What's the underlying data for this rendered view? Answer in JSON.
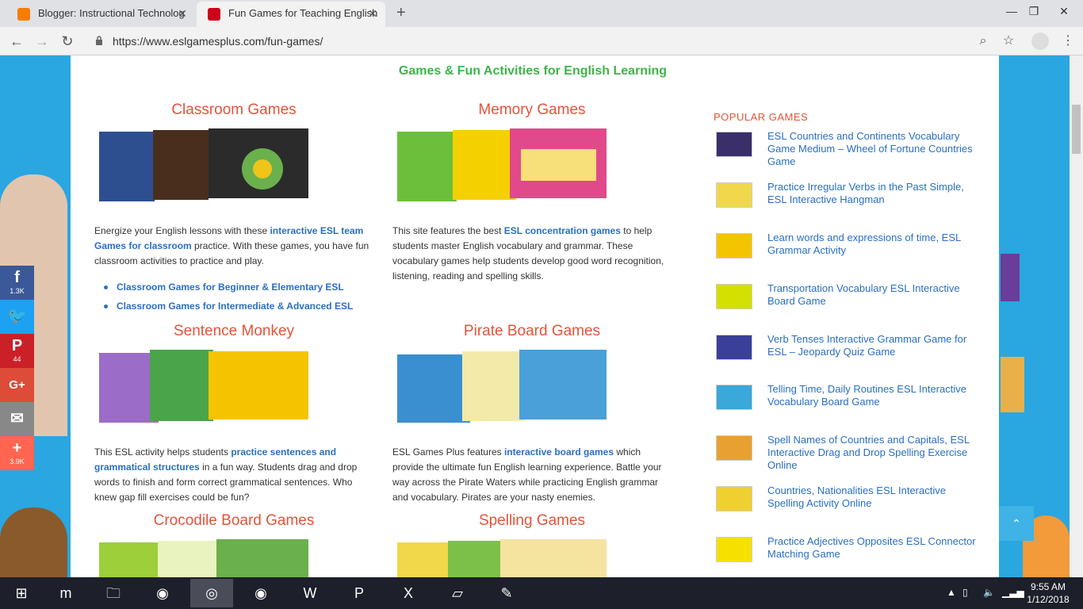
{
  "tabs": [
    {
      "label": "Blogger: Instructional Technolog",
      "active": false
    },
    {
      "label": "Fun Games for Teaching English",
      "active": true
    }
  ],
  "address": {
    "url": "https://www.eslgamesplus.com/fun-games/"
  },
  "page": {
    "headline": "Games & Fun Activities for English Learning",
    "cards": [
      {
        "title": "Classroom Games",
        "text_before": "Energize your English lessons with these ",
        "link": "interactive ESL team Games for classroom",
        "text_after": " practice. With these games, you have fun classroom activities to practice and play.",
        "bullets": [
          "Classroom Games for Beginner & Elementary ESL",
          "Classroom Games for Intermediate & Advanced ESL"
        ]
      },
      {
        "title": "Memory Games",
        "text_before": "This site features the best ",
        "link": "ESL concentration games",
        "text_after": " to help students master English vocabulary and grammar. These vocabulary games help students develop good word recognition, listening, reading and spelling skills."
      },
      {
        "title": "Sentence Monkey",
        "text_before": "This ESL activity helps students ",
        "link": "practice sentences and grammatical structures",
        "text_after": " in a fun way. Students drag and drop words to finish and form correct grammatical sentences.  Who knew gap fill exercises could be fun?"
      },
      {
        "title": "Pirate Board Games",
        "text_before": "ESL Games Plus features ",
        "link": "interactive board games",
        "text_after": " which provide the ultimate fun English  learning experience. Battle your way across the Pirate Waters while practicing English grammar and vocabulary. Pirates are your nasty enemies."
      },
      {
        "title": "Crocodile Board Games"
      },
      {
        "title": "Spelling Games"
      }
    ],
    "popular_title": "POPULAR GAMES",
    "popular": [
      "ESL Countries and Continents Vocabulary Game Medium – Wheel of Fortune Countries Game",
      "Practice Irregular Verbs in the Past Simple, ESL Interactive Hangman",
      "Learn words and expressions of time, ESL Grammar Activity",
      "Transportation Vocabulary ESL Interactive Board Game",
      "Verb Tenses Interactive Grammar Game for ESL – Jeopardy Quiz Game",
      "Telling Time, Daily Routines ESL Interactive Vocabulary Board Game",
      "Spell Names of Countries and Capitals, ESL Interactive Drag and Drop Spelling Exercise Online",
      "Countries, Nationalities ESL Interactive Spelling Activity Online",
      "Practice Adjectives Opposites ESL Connector Matching Game"
    ]
  },
  "share": [
    {
      "glyph": "f",
      "count": "1.3K",
      "color": "#3b5998"
    },
    {
      "glyph": "t",
      "count": "",
      "color": "#1da1f2"
    },
    {
      "glyph": "P",
      "count": "44",
      "color": "#cb2027"
    },
    {
      "glyph": "G+",
      "count": "",
      "color": "#dd4b39"
    },
    {
      "glyph": "✉",
      "count": "",
      "color": "#888888"
    },
    {
      "glyph": "+",
      "count": "3.9K",
      "color": "#ff6550"
    }
  ],
  "taskbar": {
    "time": "9:55 AM",
    "date": "1/12/2018"
  },
  "colors": {
    "accent_green": "#3db54a",
    "accent_orange": "#e5533a",
    "link_blue": "#2a6fc4",
    "sky": "#2aa6e0"
  }
}
